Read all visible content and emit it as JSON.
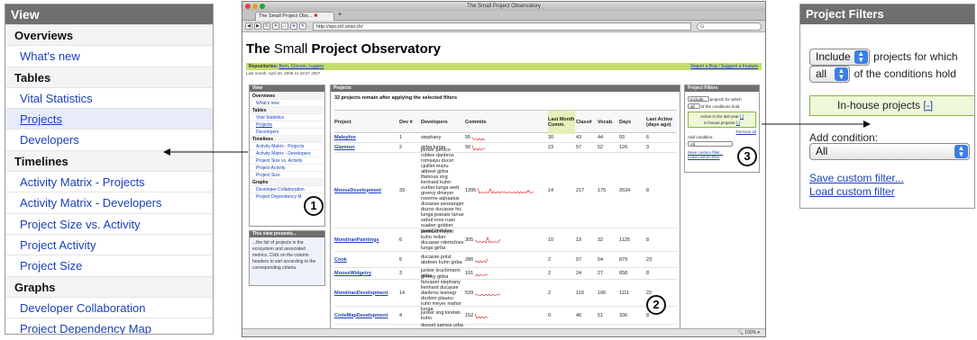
{
  "left_view": {
    "title": "View",
    "rows": [
      {
        "label": "Overviews",
        "kind": "section"
      },
      {
        "label": "What's new",
        "kind": "link"
      },
      {
        "label": "Tables",
        "kind": "section"
      },
      {
        "label": "Vital Statistics",
        "kind": "link"
      },
      {
        "label": "Projects",
        "kind": "selected"
      },
      {
        "label": "Developers",
        "kind": "link"
      },
      {
        "label": "Timelines",
        "kind": "section"
      },
      {
        "label": "Activity Matrix - Projects",
        "kind": "link"
      },
      {
        "label": "Activity Matrix - Developers",
        "kind": "link"
      },
      {
        "label": "Project Size vs. Activity",
        "kind": "link"
      },
      {
        "label": "Project Activity",
        "kind": "link"
      },
      {
        "label": "Project Size",
        "kind": "link"
      },
      {
        "label": "Graphs",
        "kind": "section"
      },
      {
        "label": "Developer Collaboration",
        "kind": "link"
      },
      {
        "label": "Project Dependency Map",
        "kind": "link"
      }
    ]
  },
  "right_filters": {
    "title": "Project Filters",
    "include_value": "Include",
    "include_text": "projects for which",
    "all_value": "all",
    "all_text": "of the conditions hold",
    "condition_label": "In-house projects",
    "remove_link": "[-]",
    "add_label": "Add condition:",
    "add_value": "All",
    "save_link": "Save custom filter...",
    "load_link": "Load custom filter"
  },
  "browser": {
    "window_title": "The Small Project Observatory",
    "tab_title": "The Small Project Obs...",
    "url": "http://spo.inf.unisi.ch/",
    "search_placeholder": "G",
    "status_zoom": "100%"
  },
  "site": {
    "title_prefix": "The",
    "title_small": "Small",
    "title_rest": "Project Observatory",
    "repos_label": "Repositories:",
    "repos": "Bern, Cincom, Lugano",
    "report_link": "Report a Bug / Suggest a Feature",
    "last_month": "Last month: April 20, 2008 21:49:07 2007"
  },
  "mini_view": {
    "title": "View",
    "rows": [
      {
        "label": "Overviews",
        "kind": "section"
      },
      {
        "label": "What's new",
        "kind": "link"
      },
      {
        "label": "Tables",
        "kind": "section"
      },
      {
        "label": "Vital Statistics",
        "kind": "link"
      },
      {
        "label": "Projects",
        "kind": "selected"
      },
      {
        "label": "Developers",
        "kind": "link"
      },
      {
        "label": "Timelines",
        "kind": "section"
      },
      {
        "label": "Activity Matrix - Projects",
        "kind": "link"
      },
      {
        "label": "Activity Matrix - Developers",
        "kind": "link"
      },
      {
        "label": "Project Size vs. Activity",
        "kind": "link"
      },
      {
        "label": "Project Activity",
        "kind": "link"
      },
      {
        "label": "Project Size",
        "kind": "link"
      },
      {
        "label": "Graphs",
        "kind": "section"
      },
      {
        "label": "Developer Collaboration",
        "kind": "link"
      },
      {
        "label": "Project Dependency M",
        "kind": "link"
      }
    ],
    "presents_title": "This view presents...",
    "presents_text": "...the list of projects in the ecosystem and associated metrics. Click on the column headers to sort according to the corresponding criteria."
  },
  "projects": {
    "title": "Projects",
    "count_text": "32 projects remain after applying the selected filters",
    "columns": [
      "Project",
      "Dev #",
      "Developers",
      "Commits",
      "Last Month Comm.",
      "Class#",
      "Vocab.",
      "Days",
      "Last Active (days ago)"
    ],
    "rows": [
      {
        "name": "Maleplon",
        "dev": "1",
        "devs": "stephany",
        "commits": "55",
        "last": "30",
        "classes": "43",
        "vocab": "44",
        "days": "93",
        "active": "6"
      },
      {
        "name": "Glamour",
        "dev": "2",
        "devs": "girba lunga",
        "commits": "90",
        "last": "23",
        "classes": "57",
        "vocab": "52",
        "days": "126",
        "active": "3"
      },
      {
        "name": "MooseDevelopment",
        "dev": "33",
        "devs": "junker perscs roblee danbros romsayu ducer cjuillet mariu abbeel girba lfamous sng lienhard kuhn zurber lunga wett greevy dmeyer roverne aqhaalus dusasse pessanger dozos ducasse hic lunga jeanaio lanue sahul roos ruan suaber gobber gaaaf lindober",
        "commits": "1395",
        "last": "14",
        "classes": "217",
        "vocab": "175",
        "days": "2634",
        "active": "8"
      },
      {
        "name": "MondrianPaintings",
        "dev": "6",
        "devs": "lienhard meyer kuhn reiber ducasse rdemchies lunga girba",
        "commits": "305",
        "last": "10",
        "classes": "19",
        "vocab": "32",
        "days": "1125",
        "active": "8"
      },
      {
        "name": "Cook",
        "dev": "5",
        "devs": "ducasse polst abdeen kuhn girba",
        "commits": "286",
        "last": "2",
        "classes": "97",
        "vocab": "54",
        "days": "879",
        "active": "23"
      },
      {
        "name": "MooseWidgetry",
        "dev": "3",
        "devs": "junker kruchmann girba",
        "commits": "101",
        "last": "2",
        "classes": "24",
        "vocab": "27",
        "days": "658",
        "active": "8"
      },
      {
        "name": "MondrianDevelopment",
        "dev": "14",
        "devs": "greevy girba faruquet stephany lienhard ducasse danbros lesnegr dozlem plaanu ruhn meyer mahor lunga",
        "commits": "539",
        "last": "2",
        "classes": "119",
        "vocab": "106",
        "days": "1111",
        "active": "22"
      },
      {
        "name": "CodeMapDevelopment",
        "dev": "4",
        "devs": "junker sng loretan kuhn",
        "commits": "152",
        "last": "0",
        "classes": "46",
        "vocab": "51",
        "days": "336",
        "active": "8"
      },
      {
        "name": "",
        "dev": "",
        "devs": "dosset samea urba miniat",
        "commits": "",
        "last": "",
        "classes": "",
        "vocab": "",
        "days": "",
        "active": ""
      }
    ]
  },
  "mini_filter": {
    "title": "Project Filters",
    "include_value": "Include",
    "include_text": "projects for which",
    "all_value": "all",
    "all_text": "of the conditions hold",
    "cond1": "Active in the last year",
    "cond2": "In-house projects",
    "remove": "[-]",
    "remove_all": "Remove all",
    "add_label": "Add condition:",
    "add_value": "All",
    "save": "Save custom filter...",
    "load": "Load custom filter"
  },
  "badges": [
    "1",
    "2",
    "3"
  ],
  "colors": {
    "header_gray": "#6f6f6f",
    "link_blue": "#1a3fb8",
    "green_bar": "#c3dd6a",
    "filter_green": "#eef7d8",
    "sparkline_red": "#d33"
  }
}
